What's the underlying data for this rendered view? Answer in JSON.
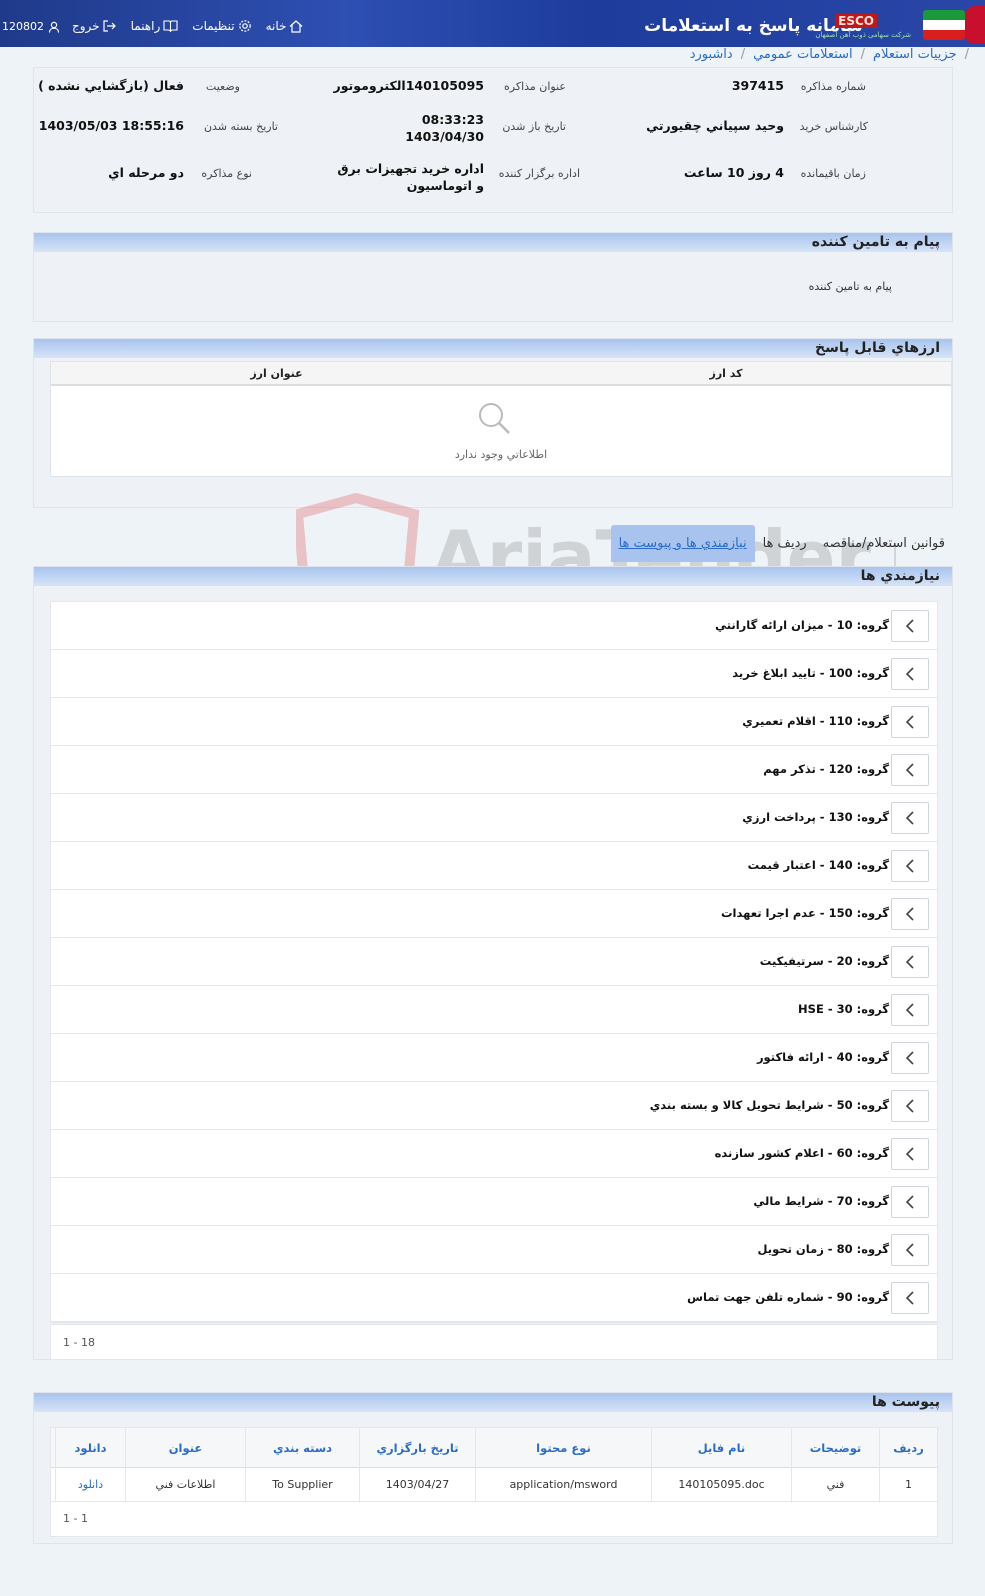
{
  "header": {
    "user_id": "120802",
    "nav": {
      "logout": "خروج",
      "help": "راهنما",
      "settings": "تنظيمات",
      "home": "خانه"
    },
    "app_title": "سامانه پاسخ به استعلامات",
    "brand": "ESCO",
    "brand_sub": "شرکت سهامی ذوب آهن اصفهان"
  },
  "breadcrumb": [
    "داشبورد",
    "استعلامات عمومي",
    "جزييات استعلام"
  ],
  "info": {
    "labels": {
      "number": "شماره مذاکره",
      "title": "عنوان مذاکره",
      "status": "وضعيت",
      "expert": "کارشناس خريد",
      "open_date": "تاريخ باز شدن",
      "close_date": "تاريخ بسته شدن",
      "remaining": "زمان باقيمانده",
      "office": "اداره برگزار کننده",
      "type": "نوع مذاکره"
    },
    "values": {
      "number": "397415",
      "title": "140105095الکتروموتور",
      "status": "فعال (بازگشايي نشده )",
      "expert": "وحيد سپياني چقيورتي",
      "open_time": "08:33:23",
      "open_date": "1403/04/30",
      "close_date": "1403/05/03 18:55:16",
      "remaining": "4 روز 10 ساعت",
      "office_line1": "اداره خريد تجهيزات برق",
      "office_line2": "و اتوماسيون",
      "type": "دو مرحله اي"
    }
  },
  "supplier_message": {
    "heading": "پيام به تامين کننده",
    "body": "پيام به تامين کننده"
  },
  "currencies": {
    "heading": "ارزهاي قابل پاسخ",
    "columns": [
      "کد ارز",
      "عنوان ارز"
    ],
    "empty": "اطلاعاتي وجود ندارد"
  },
  "tabs": [
    "نيازمندي ها و پيوست ها",
    "رديف ها",
    "قوانين استعلام/مناقصه"
  ],
  "requirements": {
    "heading": "نيازمندي ها",
    "items": [
      "گروه: 10 - ميزان ارائه گارانتي",
      "گروه: 100 - تاييد ابلاغ خريد",
      "گروه: 110 - اقلام تعميري",
      "گروه: 120 - تذکر مهم",
      "گروه: 130 - پرداخت ارزي",
      "گروه: 140 - اعتبار قيمت",
      "گروه: 150 - عدم اجرا تعهدات",
      "گروه: 20 - سرتيفيکيت",
      "گروه: 30 - HSE",
      "گروه: 40 - ارائه فاکتور",
      "گروه: 50 - شرايط تحويل کالا و بسته بندي",
      "گروه: 60 - اعلام کشور سازنده",
      "گروه: 70 - شرايط مالي",
      "گروه: 80 - زمان تحويل",
      "گروه: 90 - شماره تلفن جهت تماس"
    ],
    "pager": "1 - 18"
  },
  "attachments": {
    "heading": "پيوست ها",
    "columns": [
      "رديف",
      "توضيحات",
      "نام فايل",
      "نوع محتوا",
      "تاريخ بارگزاري",
      "دسته بندي",
      "عنوان",
      "دانلود"
    ],
    "rows": [
      [
        "1",
        "فني",
        "140105095.doc",
        "application/msword",
        "1403/04/27",
        "To Supplier",
        "اطلاعات فني",
        "دانلود"
      ]
    ],
    "pager": "1 - 1"
  },
  "watermark": "AriaTender.neT"
}
